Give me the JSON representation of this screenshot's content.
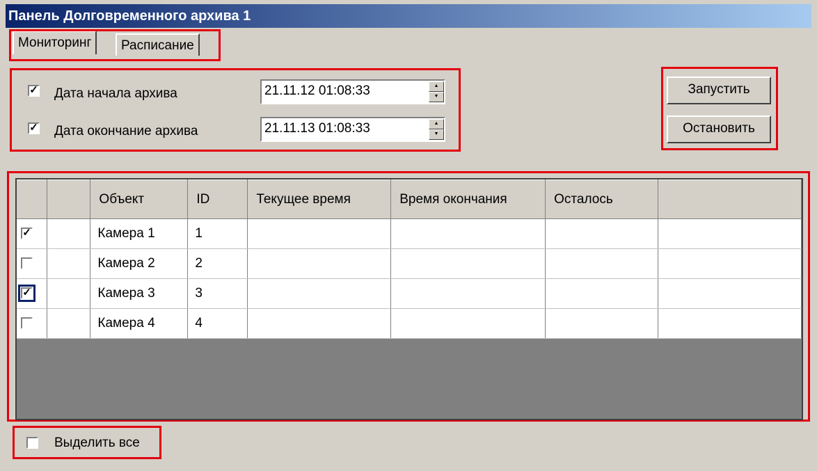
{
  "window": {
    "title": "Панель Долговременного архива 1"
  },
  "tabs": [
    {
      "label": "Мониторинг",
      "active": true
    },
    {
      "label": "Расписание",
      "active": false
    }
  ],
  "archive": {
    "start": {
      "label": "Дата начала архива",
      "checked": true,
      "value": "21.11.12 01:08:33"
    },
    "end": {
      "label": "Дата окончание архива",
      "checked": true,
      "value": "21.11.13 01:08:33"
    }
  },
  "buttons": {
    "start": "Запустить",
    "stop": "Остановить"
  },
  "table": {
    "columns": [
      "",
      "",
      "Объект",
      "ID",
      "Текущее время",
      "Время окончания",
      "Осталось",
      ""
    ],
    "rows": [
      {
        "checked": true,
        "object": "Камера 1",
        "id": "1",
        "current": "",
        "end": "",
        "left": ""
      },
      {
        "checked": false,
        "object": "Камера 2",
        "id": "2",
        "current": "",
        "end": "",
        "left": ""
      },
      {
        "checked": true,
        "object": "Камера 3",
        "id": "3",
        "current": "",
        "end": "",
        "left": "",
        "focused": true
      },
      {
        "checked": false,
        "object": "Камера 4",
        "id": "4",
        "current": "",
        "end": "",
        "left": ""
      }
    ]
  },
  "select_all": {
    "label": "Выделить все",
    "checked": false
  },
  "colors": {
    "highlight": "#e3000f",
    "titlebar_start": "#0a246a",
    "titlebar_end": "#a6caf0",
    "face": "#d4d0c8"
  },
  "icons": {
    "check": "checkmark-icon",
    "spin_up": "arrow-up-icon",
    "spin_down": "arrow-down-icon"
  }
}
